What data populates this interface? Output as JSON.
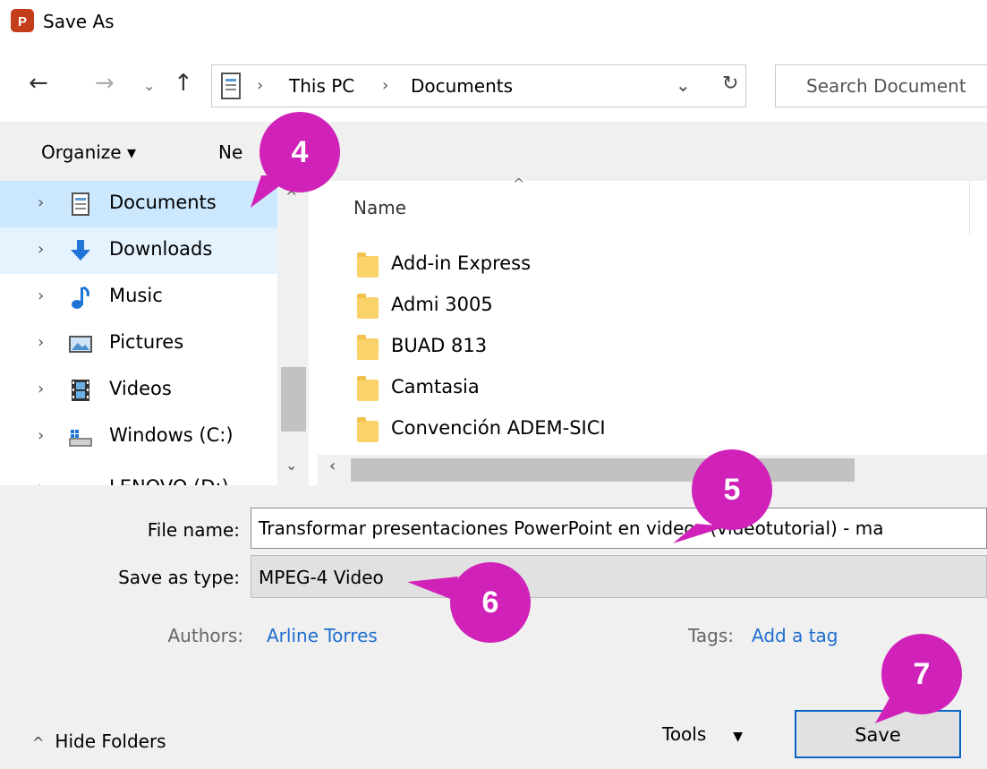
{
  "window": {
    "title": "Save As",
    "app_icon_letter": "P"
  },
  "nav": {
    "breadcrumb": [
      "This PC",
      "Documents"
    ],
    "search_placeholder": "Search Document"
  },
  "toolbar": {
    "organize_label": "Organize ▾",
    "new_folder_label": "Ne"
  },
  "sidebar": {
    "items": [
      {
        "label": "Documents",
        "icon": "documents-icon"
      },
      {
        "label": "Downloads",
        "icon": "download-arrow-icon"
      },
      {
        "label": "Music",
        "icon": "music-note-icon"
      },
      {
        "label": "Pictures",
        "icon": "pictures-icon"
      },
      {
        "label": "Videos",
        "icon": "film-icon"
      },
      {
        "label": "Windows (C:)",
        "icon": "drive-icon"
      },
      {
        "label": "LENOVO (D:)",
        "icon": "drive-icon"
      }
    ]
  },
  "filelist": {
    "column_header": "Name",
    "items": [
      "Add-in Express",
      "Admi 3005",
      "BUAD 813",
      "Camtasia",
      "Convención ADEM-SICI"
    ]
  },
  "form": {
    "file_name_label": "File name:",
    "file_name_value": "Transformar presentaciones PowerPoint en videos (videotutorial) - ma",
    "save_type_label": "Save as type:",
    "save_type_value": "MPEG-4 Video",
    "authors_label": "Authors:",
    "authors_value": "Arline Torres",
    "tags_label": "Tags:",
    "tags_value": "Add a tag"
  },
  "footer": {
    "hide_folders": "Hide Folders",
    "tools": "Tools",
    "save": "Save"
  },
  "annotations": [
    "4",
    "5",
    "6",
    "7"
  ],
  "colors": {
    "badge": "#d022b8",
    "link": "#1e6ecf",
    "selected": "#cce8ff",
    "ppt": "#c43e1c"
  }
}
